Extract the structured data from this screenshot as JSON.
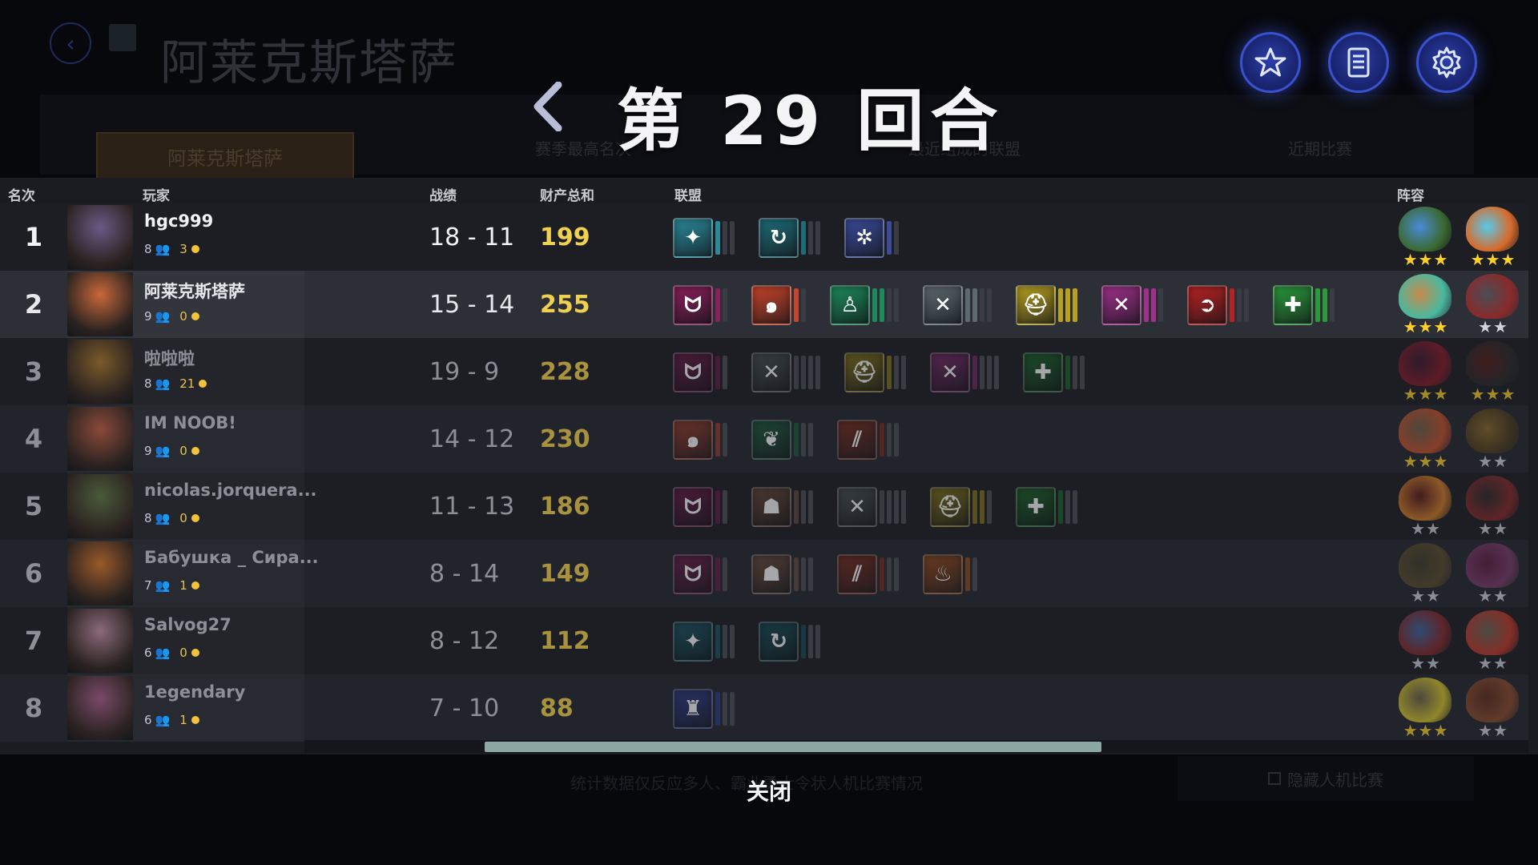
{
  "background": {
    "title": "阿莱克斯塔萨",
    "name_plate": "阿莱克斯塔萨",
    "tabs": [
      "赛季最高名次",
      "最近组成的联盟",
      "近期比赛"
    ],
    "footer_text": "统计数据仅反应多人、霸业勇士令状人机比赛情况",
    "hide_bots_label": "隐藏人机比赛"
  },
  "top_buttons": [
    {
      "name": "favorites",
      "icon": "star-icon"
    },
    {
      "name": "log",
      "icon": "document-icon"
    },
    {
      "name": "settings",
      "icon": "gear-icon"
    }
  ],
  "header": {
    "round_label": "第 29 回合",
    "back_icon": "chevron-left-icon"
  },
  "columns": {
    "rank": "名次",
    "player": "玩家",
    "record": "战绩",
    "networth": "财产总和",
    "alliances": "联盟",
    "lineup": "阵容"
  },
  "colors": {
    "gold_text": "#f0d050",
    "scrollbar": "#8aa7a4",
    "button_glow": "#3a52d0"
  },
  "players": [
    {
      "rank": "1",
      "name": "hgc999",
      "people": "8",
      "gold": "3",
      "record": "18 - 11",
      "networth": "199",
      "style": "hi",
      "avatar": "#6a5a86",
      "alliances": [
        {
          "icon": "✦",
          "color": "#2a8a9a",
          "pips": [
            1,
            0,
            0
          ]
        },
        {
          "icon": "↻",
          "color": "#1e6c78",
          "pips": [
            1,
            0,
            0
          ]
        },
        {
          "icon": "✲",
          "color": "#3b4b9a",
          "pips": [
            1,
            0
          ]
        }
      ],
      "lineup": [
        {
          "colors": [
            "#4a8ad8",
            "#3a6a30"
          ],
          "stars": "★★★",
          "tier": "gold"
        },
        {
          "colors": [
            "#58c8e8",
            "#d86a2a"
          ],
          "stars": "★★★",
          "tier": "gold"
        }
      ]
    },
    {
      "rank": "2",
      "name": "阿莱克斯塔萨",
      "people": "9",
      "gold": "0",
      "record": "15 - 14",
      "networth": "255",
      "style": "me",
      "avatar": "#c8683a",
      "alliances": [
        {
          "icon": "ᗢ",
          "color": "#8a1f5a",
          "pips": [
            1,
            0
          ]
        },
        {
          "icon": "๑",
          "color": "#c8442a",
          "pips": [
            1,
            0
          ]
        },
        {
          "icon": "♙",
          "color": "#1c8a5a",
          "pips": [
            1,
            1,
            0,
            0
          ]
        },
        {
          "icon": "✕",
          "color": "#5c6a70",
          "pips": [
            1,
            1,
            0,
            0
          ]
        },
        {
          "icon": "⛑",
          "color": "#b8a020",
          "pips": [
            1,
            1,
            1
          ]
        },
        {
          "icon": "✕",
          "color": "#a0308a",
          "pips": [
            1,
            1,
            0
          ]
        },
        {
          "icon": "➲",
          "color": "#b82222",
          "pips": [
            1,
            0,
            0
          ]
        },
        {
          "icon": "✚",
          "color": "#2a9a3a",
          "pips": [
            1,
            1,
            0
          ]
        }
      ],
      "lineup": [
        {
          "colors": [
            "#c88a4a",
            "#48b8a0"
          ],
          "stars": "★★★",
          "tier": "gold"
        },
        {
          "colors": [
            "#4a4e58",
            "#8a2a2a"
          ],
          "stars": "★★",
          "tier": "silver"
        }
      ]
    },
    {
      "rank": "3",
      "name": "啦啦啦",
      "people": "8",
      "gold": "21",
      "record": "19 - 9",
      "networth": "228",
      "style": "dim",
      "avatar": "#7a5a2a",
      "alliances": [
        {
          "icon": "ᗢ",
          "color": "#6a1a48",
          "pips": [
            1,
            0
          ]
        },
        {
          "icon": "✕",
          "color": "#4a5458",
          "pips": [
            1,
            1,
            0,
            0
          ]
        },
        {
          "icon": "⛑",
          "color": "#8a7a1a",
          "pips": [
            1,
            0,
            0
          ]
        },
        {
          "icon": "✕",
          "color": "#7a2a6a",
          "pips": [
            1,
            0,
            0,
            0
          ]
        },
        {
          "icon": "✚",
          "color": "#1a6a2a",
          "pips": [
            1,
            0,
            0
          ]
        }
      ],
      "lineup": [
        {
          "colors": [
            "#3a1a30",
            "#8a1a2a"
          ],
          "stars": "★★★",
          "tier": "gold"
        },
        {
          "colors": [
            "#5a1a1a",
            "#2a2a2a"
          ],
          "stars": "★★★",
          "tier": "gold"
        }
      ]
    },
    {
      "rank": "4",
      "name": "IM NOOB!",
      "people": "9",
      "gold": "0",
      "record": "14 - 12",
      "networth": "230",
      "style": "dim",
      "avatar": "#8a4a3a",
      "alliances": [
        {
          "icon": "๑",
          "color": "#9a3a2a",
          "pips": [
            1,
            0
          ]
        },
        {
          "icon": "❦",
          "color": "#1a5a3a",
          "pips": [
            1,
            0,
            0
          ]
        },
        {
          "icon": "⫽",
          "color": "#7a2a1a",
          "pips": [
            1,
            0,
            0
          ]
        }
      ],
      "lineup": [
        {
          "colors": [
            "#6a6048",
            "#c8502a"
          ],
          "stars": "★★★",
          "tier": "gold"
        },
        {
          "colors": [
            "#8a6a2a",
            "#4a3a1a"
          ],
          "stars": "★★",
          "tier": "silver"
        }
      ]
    },
    {
      "rank": "5",
      "name": "nicolas.jorquera...",
      "people": "8",
      "gold": "0",
      "record": "11 - 13",
      "networth": "186",
      "style": "dim",
      "avatar": "#4a5a3a",
      "alliances": [
        {
          "icon": "ᗢ",
          "color": "#6a1a48",
          "pips": [
            1,
            0
          ]
        },
        {
          "icon": "☗",
          "color": "#6a4a3a",
          "pips": [
            1,
            0,
            0
          ]
        },
        {
          "icon": "✕",
          "color": "#4a5458",
          "pips": [
            1,
            0,
            0,
            0
          ]
        },
        {
          "icon": "⛑",
          "color": "#8a7a1a",
          "pips": [
            1,
            1,
            0
          ]
        },
        {
          "icon": "✚",
          "color": "#1a6a2a",
          "pips": [
            1,
            0,
            0
          ]
        }
      ],
      "lineup": [
        {
          "colors": [
            "#5a1a1a",
            "#d8802a"
          ],
          "stars": "★★",
          "tier": "silver"
        },
        {
          "colors": [
            "#2a2a2a",
            "#8a2a2a"
          ],
          "stars": "★★",
          "tier": "silver"
        }
      ]
    },
    {
      "rank": "6",
      "name": "Бабушка _ Сира...",
      "people": "7",
      "gold": "1",
      "record": "8 - 14",
      "networth": "149",
      "style": "dim",
      "avatar": "#9a5a2a",
      "alliances": [
        {
          "icon": "ᗢ",
          "color": "#6a1a48",
          "pips": [
            1,
            0
          ]
        },
        {
          "icon": "☗",
          "color": "#6a4a3a",
          "pips": [
            1,
            0,
            0
          ]
        },
        {
          "icon": "⫽",
          "color": "#7a2a1a",
          "pips": [
            1,
            0,
            0
          ]
        },
        {
          "icon": "♨",
          "color": "#9a4a1a",
          "pips": [
            1,
            0
          ]
        }
      ],
      "lineup": [
        {
          "colors": [
            "#3a3a2a",
            "#5a4a2a"
          ],
          "stars": "★★",
          "tier": "silver"
        },
        {
          "colors": [
            "#5a1a3a",
            "#7a3a6a"
          ],
          "stars": "★★",
          "tier": "silver"
        }
      ]
    },
    {
      "rank": "7",
      "name": "Salvog27",
      "people": "6",
      "gold": "0",
      "record": "8 - 12",
      "networth": "112",
      "style": "dim",
      "avatar": "#8a6a7a",
      "alliances": [
        {
          "icon": "✦",
          "color": "#1a5a6a",
          "pips": [
            1,
            0,
            0
          ]
        },
        {
          "icon": "↻",
          "color": "#15505a",
          "pips": [
            1,
            0,
            0
          ]
        }
      ],
      "lineup": [
        {
          "colors": [
            "#3a6aa8",
            "#8a2a2a"
          ],
          "stars": "★★",
          "tier": "silver"
        },
        {
          "colors": [
            "#6a6a5a",
            "#c83a2a"
          ],
          "stars": "★★",
          "tier": "silver"
        }
      ]
    },
    {
      "rank": "8",
      "name": "1egendary",
      "people": "6",
      "gold": "1",
      "record": "7 - 10",
      "networth": "88",
      "style": "dim",
      "avatar": "#7a4a6a",
      "alliances": [
        {
          "icon": "♜",
          "color": "#2a3a8a",
          "pips": [
            1,
            0,
            0
          ]
        }
      ],
      "lineup": [
        {
          "colors": [
            "#6a6048",
            "#d8c82a"
          ],
          "stars": "★★★",
          "tier": "gold"
        },
        {
          "colors": [
            "#5a2a1a",
            "#8a4a2a"
          ],
          "stars": "★★",
          "tier": "silver"
        }
      ]
    }
  ],
  "close_label": "关闭"
}
